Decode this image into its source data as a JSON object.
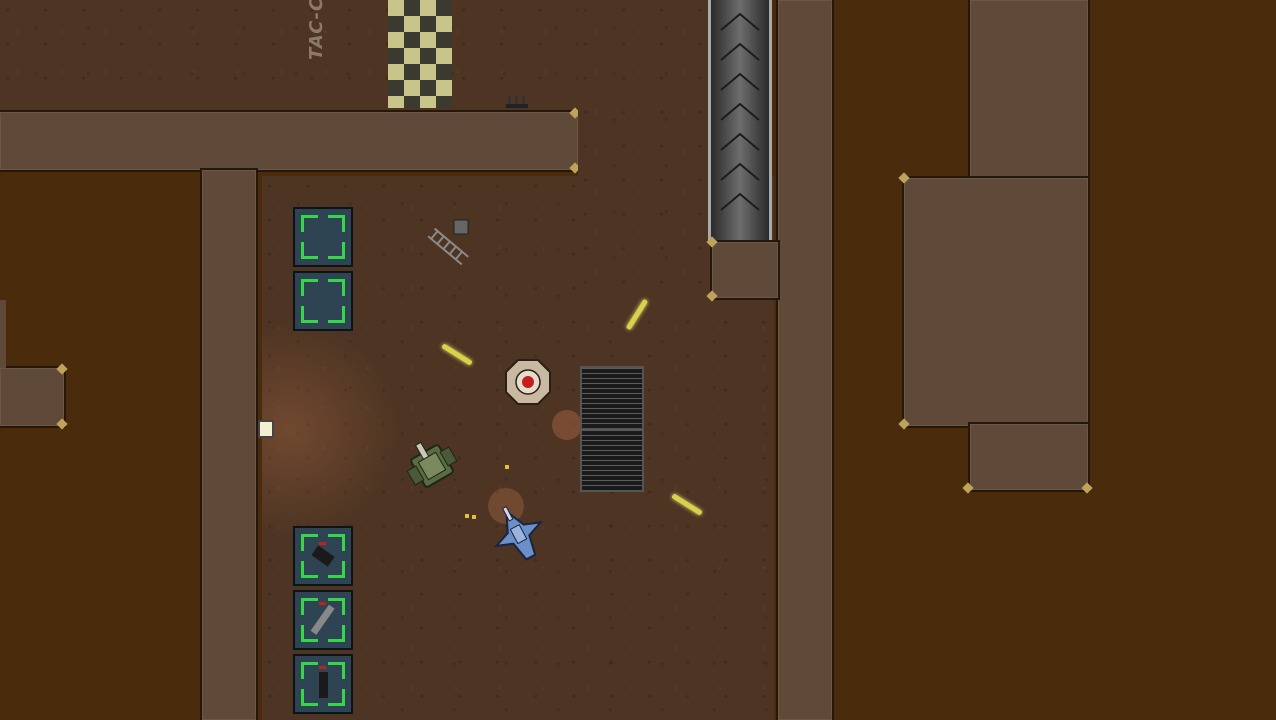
{
  "hud": {
    "floor_stencil": "TAC-C"
  },
  "colors": {
    "outer_ground": "#4a2c0d",
    "floor": "#4d3423",
    "wall": "#5f4a3a",
    "bullet": "#d8d24a",
    "crate_marker": "#37d64a",
    "player": "#6b8fc9",
    "enemy_mech": "#5a6b45",
    "turret_core": "#c41e1e"
  },
  "entities": {
    "player": {
      "icon": "blue-mech-icon"
    },
    "enemy": {
      "icon": "green-mech-icon"
    },
    "turret": {
      "icon": "turret-icon"
    },
    "pickups": [
      {
        "name": "weapon-crate-1",
        "icon": "weapon-icon"
      },
      {
        "name": "weapon-crate-2",
        "icon": "weapon-icon"
      },
      {
        "name": "weapon-crate-3",
        "icon": "weapon-icon"
      }
    ]
  }
}
